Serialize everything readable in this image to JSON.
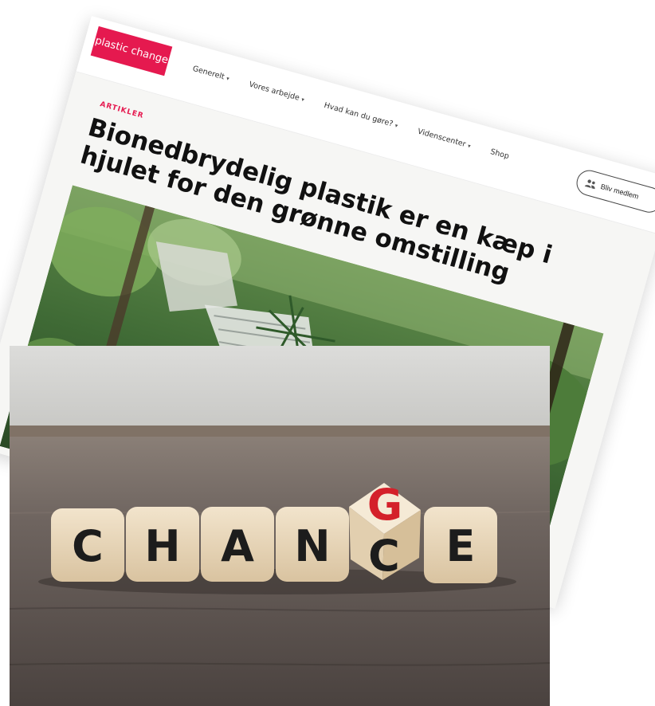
{
  "website": {
    "logo_text": "plastic change",
    "nav": [
      {
        "label": "Generelt",
        "has_dropdown": true
      },
      {
        "label": "Vores arbejde",
        "has_dropdown": true
      },
      {
        "label": "Hvad kan du gøre?",
        "has_dropdown": true
      },
      {
        "label": "Videnscenter",
        "has_dropdown": true
      },
      {
        "label": "Shop",
        "has_dropdown": false
      }
    ],
    "member_button": "Bliv medlem",
    "kicker": "ARTIKLER",
    "headline": "Bionedbrydelig plastik er en kæp i hjulet for den grønne omstilling",
    "dropdown_icon": "chevron-down-icon",
    "member_icon": "users-icon"
  },
  "photo": {
    "dice_letters": [
      "C",
      "H",
      "A",
      "N",
      "C",
      "E"
    ],
    "turned_die": {
      "top": "G",
      "front": "C"
    }
  },
  "colors": {
    "brand_pink": "#e5194f",
    "accent_red": "#d4202a"
  }
}
